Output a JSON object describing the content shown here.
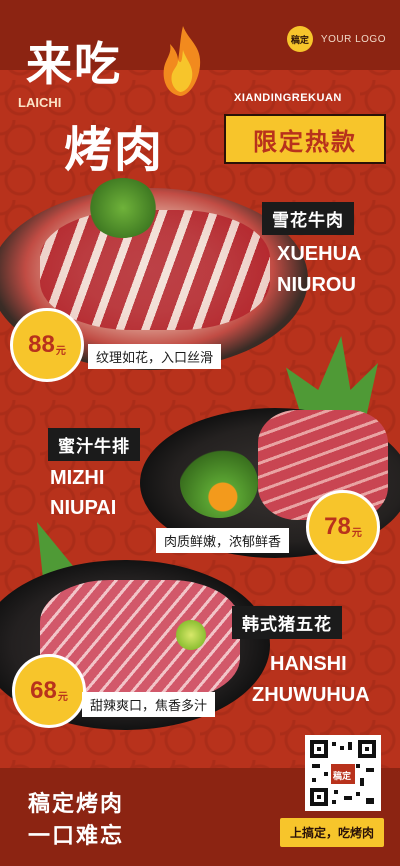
{
  "brand": {
    "logo_badge": "稿定",
    "logo_text": "YOUR LOGO"
  },
  "header": {
    "title_line1": "来吃",
    "pinyin_line1": "LAICHI",
    "title_line2": "烤肉",
    "sub_pinyin": "XIANDINGREKUAN",
    "tag": "限定热款"
  },
  "items": [
    {
      "name": "雪花牛肉",
      "pinyin1": "XUEHUA",
      "pinyin2": "NIUROU",
      "price": "88",
      "unit": "元",
      "desc": "纹理如花，入口丝滑"
    },
    {
      "name": "蜜汁牛排",
      "pinyin1": "MIZHI",
      "pinyin2": "NIUPAI",
      "price": "78",
      "unit": "元",
      "desc": "肉质鲜嫩，浓郁鲜香"
    },
    {
      "name": "韩式猪五花",
      "pinyin1": "HANSHI",
      "pinyin2": "ZHUWUHUA",
      "price": "68",
      "unit": "元",
      "desc": "甜辣爽口，焦香多汁"
    }
  ],
  "footer": {
    "slogan1": "稿定烤肉",
    "slogan2": "一口难忘",
    "qr_label": "稿定",
    "cta": "上搞定，吃烤肉"
  },
  "colors": {
    "background": "#b8321c",
    "accent": "#f7c52b",
    "dark": "#1b1b1b"
  }
}
